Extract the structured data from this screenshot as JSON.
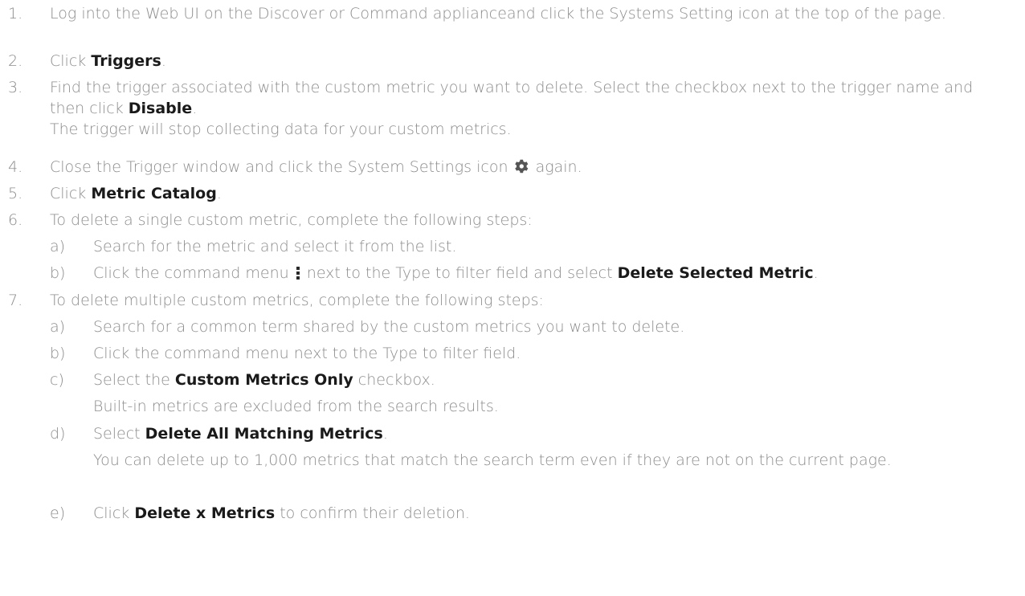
{
  "steps": [
    {
      "num": "1.",
      "text": "Log into the Web UI on the Discover or Command applianceand click the Systems Setting icon at the top of the page."
    },
    {
      "num": "2.",
      "pre": "Click ",
      "bold": "Triggers",
      "post": "."
    },
    {
      "num": "3.",
      "pre": "Find the trigger associated with the custom metric you want to delete. Select the checkbox next to the trigger name and then click ",
      "bold": "Disable",
      "post": ".",
      "note": "The trigger will stop collecting data for your custom metrics."
    },
    {
      "num": "4.",
      "pre": "Close the Trigger window and click the System Settings icon ",
      "icon": "gear-icon",
      "post": " again."
    },
    {
      "num": "5.",
      "pre": "Click ",
      "bold": "Metric Catalog",
      "post": "."
    },
    {
      "num": "6.",
      "text": "To delete a single custom metric, complete the following steps:",
      "substeps": [
        {
          "letter": "a)",
          "text": "Search for the metric and select it from the list."
        },
        {
          "letter": "b)",
          "pre": "Click the command menu ",
          "icon": "kebab-menu-icon",
          "mid": " next to the Type to filter field and select ",
          "bold": "Delete Selected Metric",
          "post": "."
        }
      ]
    },
    {
      "num": "7.",
      "text": "To delete multiple custom metrics, complete the following steps:",
      "substeps": [
        {
          "letter": "a)",
          "text": "Search for a common term shared by the custom metrics you want to delete."
        },
        {
          "letter": "b)",
          "text": "Click the command menu next to the Type to filter field."
        },
        {
          "letter": "c)",
          "pre": "Select the ",
          "bold": "Custom Metrics Only",
          "post": " checkbox.",
          "note": "Built-in metrics are excluded from the search results."
        },
        {
          "letter": "d)",
          "pre": "Select ",
          "bold": "Delete All Matching Metrics",
          "post": ".",
          "note": "You can delete up to 1,000 metrics that match the search term even if they are not on the current page."
        },
        {
          "letter": "e)",
          "pre": "Click ",
          "bold": "Delete x Metrics",
          "post": " to confirm their deletion."
        }
      ]
    }
  ]
}
